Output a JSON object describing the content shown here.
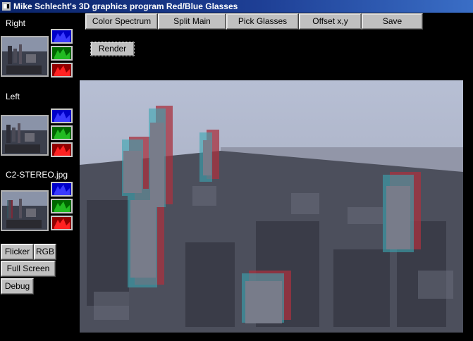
{
  "window": {
    "title": "Mike Schlecht's 3D graphics program Red/Blue Glasses"
  },
  "toolbar": {
    "color_spectrum": "Color Spectrum",
    "split_main": "Split Main",
    "pick_glasses": "Pick Glasses",
    "offset_xy": "Offset x,y",
    "save": "Save"
  },
  "render_label": "Render",
  "panels": [
    {
      "label": "Right"
    },
    {
      "label": "Left"
    },
    {
      "label": "C2-STEREO.jpg"
    }
  ],
  "controls": {
    "flicker": "Flicker",
    "rgb": "RGB",
    "full_screen": "Full Screen",
    "debug": "Debug"
  },
  "colors": {
    "title_bar": "#0a246a",
    "button_face": "#c0c0c0",
    "blue_channel": "#0000c8",
    "green_channel": "#008800",
    "red_channel": "#c00000",
    "background": "#000000"
  }
}
